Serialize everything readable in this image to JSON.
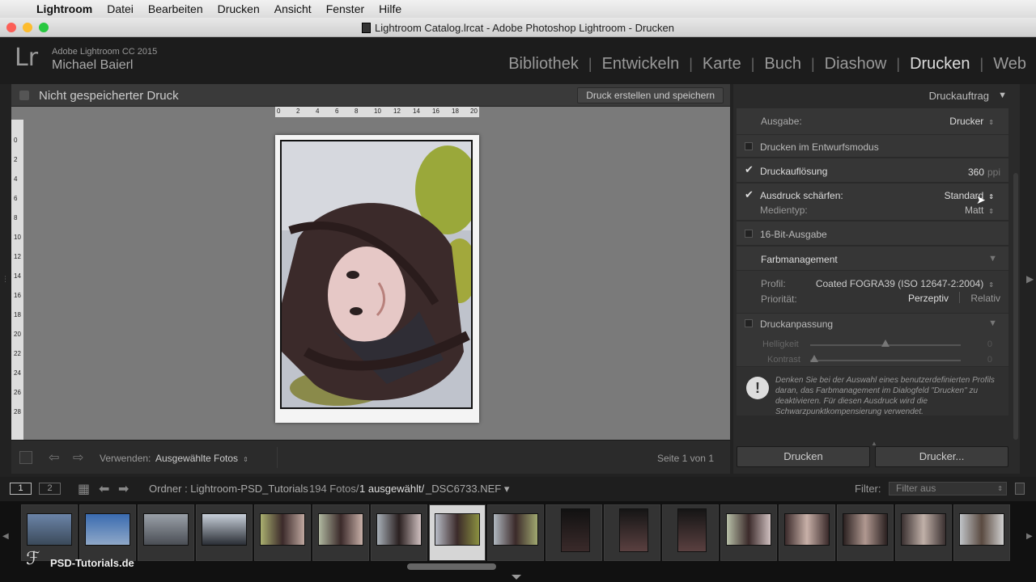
{
  "menubar": {
    "app": "Lightroom",
    "items": [
      "Datei",
      "Bearbeiten",
      "Drucken",
      "Ansicht",
      "Fenster",
      "Hilfe"
    ]
  },
  "window": {
    "title": "Lightroom Catalog.lrcat - Adobe Photoshop Lightroom - Drucken"
  },
  "identity": {
    "logo": "Lr",
    "product": "Adobe Lightroom CC 2015",
    "user": "Michael Baierl"
  },
  "modules": [
    "Bibliothek",
    "Entwickeln",
    "Karte",
    "Buch",
    "Diashow",
    "Drucken",
    "Web"
  ],
  "active_module": "Drucken",
  "center": {
    "title": "Nicht gespeicherter Druck",
    "create_button": "Druck erstellen und speichern",
    "ruler_top": [
      "0",
      "2",
      "4",
      "6",
      "8",
      "10",
      "12",
      "14",
      "16",
      "18",
      "20"
    ],
    "ruler_left": [
      "0",
      "2",
      "4",
      "6",
      "8",
      "10",
      "12",
      "14",
      "16",
      "18",
      "20",
      "22",
      "24",
      "26",
      "28"
    ]
  },
  "toolbar": {
    "use_label": "Verwenden:",
    "use_value": "Ausgewählte Fotos",
    "page": "Seite 1 von 1"
  },
  "panel": {
    "title": "Druckauftrag",
    "output_label": "Ausgabe:",
    "output_value": "Drucker",
    "draft_mode": "Drucken im Entwurfsmodus",
    "resolution_label": "Druckauflösung",
    "resolution_value": "360",
    "resolution_unit": "ppi",
    "sharpen_label": "Ausdruck schärfen:",
    "sharpen_value": "Standard",
    "media_label": "Medientyp:",
    "media_value": "Matt",
    "bit16": "16-Bit-Ausgabe",
    "color_mgmt": "Farbmanagement",
    "profile_label": "Profil:",
    "profile_value": "Coated FOGRA39 (ISO 12647-2:2004)",
    "priority_label": "Priorität:",
    "priority_a": "Perzeptiv",
    "priority_b": "Relativ",
    "adjust": "Druckanpassung",
    "brightness_label": "Helligkeit",
    "brightness_value": "0",
    "contrast_label": "Kontrast",
    "contrast_value": "0",
    "note": "Denken Sie bei der Auswahl eines benutzerdefinierten Profils daran, das Farbmanagement im Dialogfeld \"Drucken\" zu deaktivieren. Für diesen Ausdruck wird die Schwarzpunktkompensierung verwendet.",
    "print_button": "Drucken",
    "printer_button": "Drucker..."
  },
  "filmbar": {
    "screen1": "1",
    "screen2": "2",
    "folder": "Ordner : Lightroom-PSD_Tutorials",
    "count": "194 Fotos/",
    "selected": "1 ausgewählt/",
    "file": "_DSC6733.NEF",
    "filter_label": "Filter:",
    "filter_value": "Filter aus"
  },
  "watermark": "PSD-Tutorials.de",
  "colors": {
    "bg": "#222222",
    "panel": "#2a2a2a",
    "canvas": "#7a7a7a",
    "accent": "#dddddd"
  }
}
